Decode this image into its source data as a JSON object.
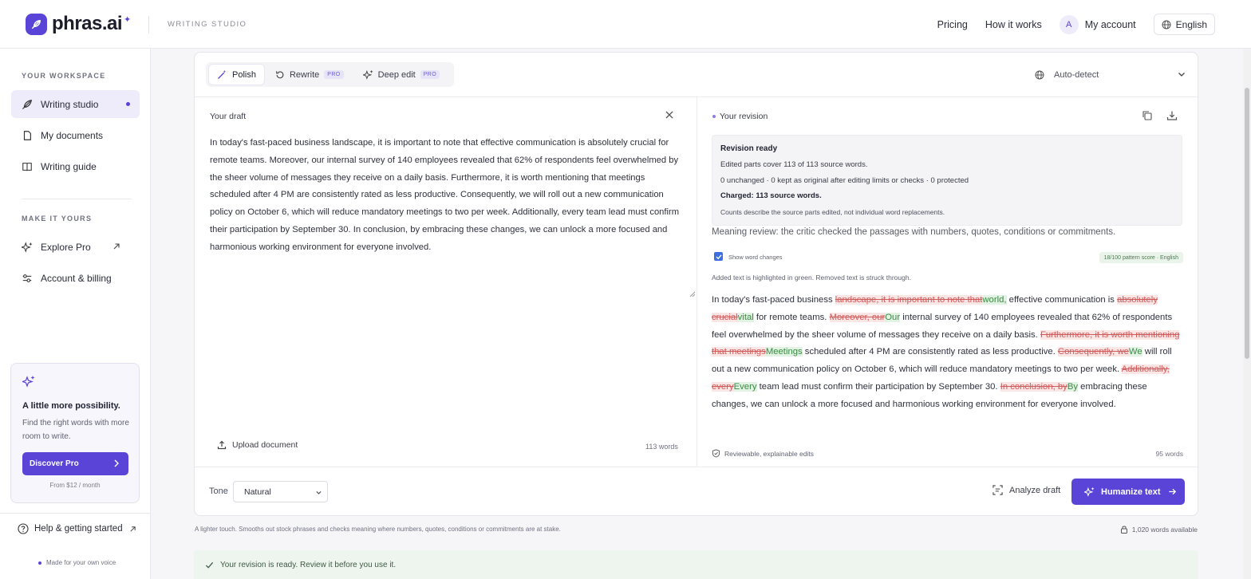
{
  "header": {
    "logo_text": "phras.ai",
    "product_tag": "WRITING STUDIO",
    "nav": [
      "Pricing",
      "How it works"
    ],
    "avatar_initial": "A",
    "account_label": "My account",
    "language": "English",
    "logo_icon": "quill-icon"
  },
  "sidebar": {
    "workspace_title": "YOUR WORKSPACE",
    "workspace_items": [
      {
        "label": "Writing studio",
        "icon": "quill-icon"
      },
      {
        "label": "My documents",
        "icon": "document-icon"
      },
      {
        "label": "Writing guide",
        "icon": "book-icon"
      }
    ],
    "make_title": "MAKE IT YOURS",
    "make_items": [
      {
        "label": "Explore Pro",
        "icon": "sparkle-icon"
      },
      {
        "label": "Account & billing",
        "icon": "sliders-icon"
      }
    ],
    "promo": {
      "title": "A little more possibility.",
      "text": "Find the right words with more room to write.",
      "button": "Discover Pro",
      "price": "From $12 / month"
    },
    "help_label": "Help & getting started",
    "footer": "Made for your own voice"
  },
  "editor": {
    "modes": [
      {
        "label": "Polish",
        "pro": ""
      },
      {
        "label": "Rewrite",
        "pro": "PRO"
      },
      {
        "label": "Deep edit",
        "pro": "PRO"
      }
    ],
    "language_select": "Auto-detect",
    "draft_label": "Your draft",
    "draft_text": "In today's fast-paced business landscape, it is important to note that effective communication is absolutely crucial for remote teams. Moreover, our internal survey of 140 employees revealed that 62% of respondents feel overwhelmed by the sheer volume of messages they receive on a daily basis. Furthermore, it is worth mentioning that meetings scheduled after 4 PM are consistently rated as less productive. Consequently, we will roll out a new communication policy on October 6, which will reduce mandatory meetings to two per week. Additionally, every team lead must confirm their participation by September 30. In conclusion, by embracing these changes, we can unlock a more focused and harmonious working environment for everyone involved.",
    "upload_label": "Upload document",
    "draft_word_count": "113 words",
    "revision_label": "Your revision",
    "summary": {
      "title": "Revision ready",
      "line1": "Edited parts cover 113 of 113 source words.",
      "line2": "0 unchanged · 0 kept as original after editing limits or checks · 0 protected",
      "charged": "Charged: 113 source words.",
      "note": "Counts describe the source parts edited, not individual word replacements."
    },
    "meaning_review": "Meaning review: the critic checked the passages with numbers, quotes, conditions or commitments.",
    "show_changes_label": "Show word changes",
    "show_changes_checked": true,
    "pattern_score": "18/100 pattern score · English",
    "legend": "Added text is highlighted in green. Removed text is struck through.",
    "revision_segments": [
      {
        "t": "keep",
        "s": "In today's fast-paced business "
      },
      {
        "t": "del",
        "s": "landscape, it is important to note that"
      },
      {
        "t": "ins",
        "s": "world,"
      },
      {
        "t": "keep",
        "s": " effective communication is "
      },
      {
        "t": "del",
        "s": "absolutely crucial"
      },
      {
        "t": "ins",
        "s": "vital"
      },
      {
        "t": "keep",
        "s": " for remote teams. "
      },
      {
        "t": "del",
        "s": "Moreover, our"
      },
      {
        "t": "ins",
        "s": "Our"
      },
      {
        "t": "keep",
        "s": " internal survey of 140 employees revealed that 62% of respondents feel overwhelmed by the sheer volume of messages they receive on a daily basis. "
      },
      {
        "t": "del",
        "s": "Furthermore, it is worth mentioning that meetings"
      },
      {
        "t": "ins",
        "s": "Meetings"
      },
      {
        "t": "keep",
        "s": " scheduled after 4 PM are consistently rated as less productive. "
      },
      {
        "t": "del",
        "s": "Consequently, we"
      },
      {
        "t": "ins",
        "s": "We"
      },
      {
        "t": "keep",
        "s": " will roll out a new communication policy on October 6, which will reduce mandatory meetings to two per week. "
      },
      {
        "t": "del",
        "s": "Additionally, every"
      },
      {
        "t": "ins",
        "s": "Every"
      },
      {
        "t": "keep",
        "s": " team lead must confirm their participation by September 30. "
      },
      {
        "t": "del",
        "s": "In conclusion, by"
      },
      {
        "t": "ins",
        "s": "By"
      },
      {
        "t": "keep",
        "s": " embracing these changes, we can unlock a more focused and harmonious working environment for everyone involved."
      }
    ],
    "reviewable_label": "Reviewable, explainable edits",
    "revision_word_count": "95 words",
    "tone_label": "Tone",
    "tone_value": "Natural",
    "analyze_label": "Analyze draft",
    "humanize_label": "Humanize text"
  },
  "footer": {
    "note": "A lighter touch. Smooths out stock phrases and checks meaning where numbers, quotes, conditions or commitments are at stake.",
    "words_available": "1,020 words available",
    "status": "Your revision is ready. Review it before you use it."
  },
  "colors": {
    "accent": "#5a44d8",
    "deleted": "#d25a5a",
    "inserted": "#3b8a45"
  }
}
